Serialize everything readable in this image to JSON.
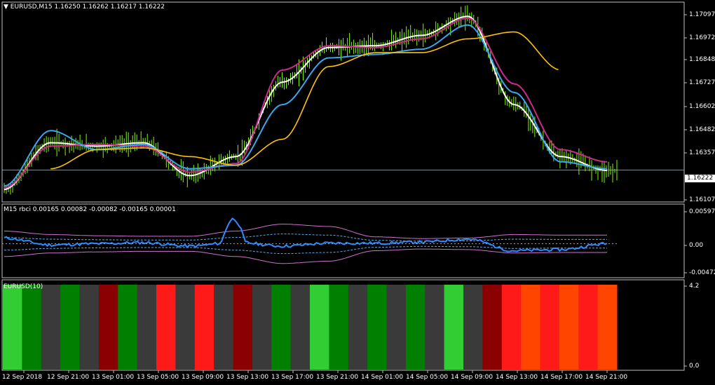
{
  "main": {
    "arrow": "▼",
    "symbol": "EURUSD,M15",
    "ohlc": [
      "1.16250",
      "1.16262",
      "1.16217",
      "1.16222"
    ],
    "current_price": "1.16222",
    "price_ticks": [
      "1.17097",
      "1.16972",
      "1.16848",
      "1.16727",
      "1.16602",
      "1.16482",
      "1.16357",
      "1.16107"
    ]
  },
  "sub1": {
    "label": "M15 rbci 0.00165 0.00082 -0.00082 -0.00165 0.00001",
    "ticks": [
      "0.00597",
      "0.00",
      "-0.00472"
    ]
  },
  "sub2": {
    "label": "EURUSD(10)",
    "ticks": [
      "4.2",
      "0.0"
    ]
  },
  "time_labels": [
    "12 Sep 2018",
    "12 Sep 21:00",
    "13 Sep 01:00",
    "13 Sep 05:00",
    "13 Sep 09:00",
    "13 Sep 13:00",
    "13 Sep 17:00",
    "13 Sep 21:00",
    "14 Sep 01:00",
    "14 Sep 05:00",
    "14 Sep 09:00",
    "14 Sep 13:00",
    "14 Sep 17:00",
    "14 Sep 21:00"
  ],
  "colors": {
    "background": "#000000",
    "grid_border": "#c0c0c0",
    "bars": "#7cfc00",
    "fast_line": "#ffffff",
    "magenta_line": "#cc2a8a",
    "blue_line": "#3aa8f0",
    "slow_line": "#ffc300",
    "rbci_line": "#2f8cff",
    "band_outer": "#d070d0",
    "band_inner": "#5aaff0"
  },
  "chart_data": [
    {
      "type": "line",
      "title": "EURUSD,M15",
      "ylim": [
        1.1605,
        1.1718
      ],
      "x": [
        "12 Sep 2018",
        "12 Sep 21:00",
        "13 Sep 01:00",
        "13 Sep 05:00",
        "13 Sep 09:00",
        "13 Sep 13:00",
        "13 Sep 17:00",
        "13 Sep 21:00",
        "14 Sep 01:00",
        "14 Sep 05:00",
        "14 Sep 09:00",
        "14 Sep 13:00",
        "14 Sep 17:00",
        "14 Sep 21:00"
      ],
      "series": [
        {
          "values": [
            1.1611,
            1.1638,
            1.1636,
            1.1638,
            1.1619,
            1.163,
            1.1673,
            1.1693,
            1.1694,
            1.17,
            1.1711,
            1.166,
            1.163,
            1.1622
          ]
        },
        {
          "values": [
            1.1612,
            1.1636,
            1.1637,
            1.1636,
            1.1621,
            1.1626,
            1.168,
            1.1694,
            1.1693,
            1.1698,
            1.171,
            1.1672,
            1.1634,
            1.1627
          ]
        },
        {
          "values": [
            1.1613,
            1.1645,
            1.1634,
            1.1637,
            1.1623,
            1.1625,
            1.166,
            1.1687,
            1.1689,
            1.1692,
            1.1706,
            1.1667,
            1.1627,
            1.1623
          ]
        },
        {
          "values": [
            null,
            1.1623,
            1.1634,
            1.1635,
            1.163,
            1.1625,
            1.164,
            1.1682,
            1.169,
            1.169,
            1.1698,
            1.1702,
            1.168,
            null
          ]
        }
      ]
    },
    {
      "type": "line",
      "title": "M15 rbci",
      "ylim": [
        -0.0055,
        0.0065
      ],
      "levels": [
        0.00165,
        0.00082,
        -0.00082,
        -0.00165
      ],
      "x": [
        "12 Sep 2018",
        "12 Sep 21:00",
        "13 Sep 01:00",
        "13 Sep 05:00",
        "13 Sep 09:00",
        "13 Sep 13:00",
        "13 Sep 17:00",
        "13 Sep 21:00",
        "14 Sep 01:00",
        "14 Sep 05:00",
        "14 Sep 09:00",
        "14 Sep 13:00",
        "14 Sep 17:00",
        "14 Sep 21:00"
      ],
      "series": [
        {
          "values": [
            0.001,
            -0.0002,
            0.0,
            0.0002,
            -0.0004,
            0.0003,
            -0.0004,
            0.0001,
            0.0001,
            0.0003,
            0.0008,
            -0.0012,
            -0.001,
            1e-05
          ]
        }
      ]
    },
    {
      "type": "heatmap",
      "title": "EURUSD(10)",
      "ylim": [
        0.0,
        4.2
      ],
      "categories": [
        "bright-green",
        "green",
        "gray",
        "dark-red",
        "red",
        "orange-red"
      ],
      "segments": [
        "bright-green",
        "green",
        "gray",
        "green",
        "gray",
        "dark-red",
        "green",
        "gray",
        "red",
        "gray",
        "red",
        "gray",
        "dark-red",
        "gray",
        "green",
        "gray",
        "bright-green",
        "green",
        "gray",
        "green",
        "gray",
        "green",
        "gray",
        "bright-green",
        "gray",
        "dark-red",
        "red",
        "orange-red",
        "red",
        "orange-red",
        "red",
        "orange-red"
      ]
    }
  ]
}
